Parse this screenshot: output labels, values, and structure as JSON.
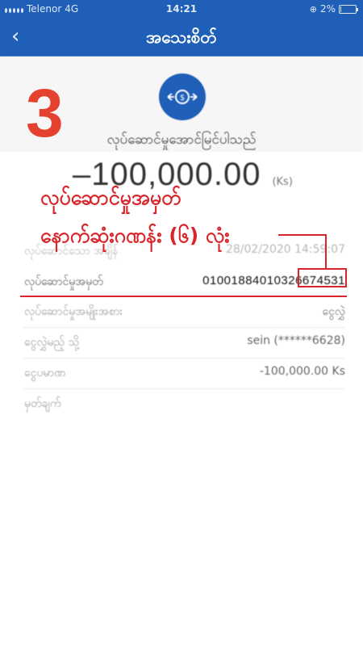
{
  "status": {
    "carrier": "Telenor",
    "network": "4G",
    "time": "14:21",
    "battery_percent": "2%",
    "battery_level": 0.02
  },
  "nav": {
    "back_icon": "chevron-left-icon",
    "title": "အသေးစိတ်"
  },
  "step_number": "3",
  "receipt": {
    "icon": "money-transfer-icon",
    "status_text": "လုပ်ဆောင်မှုအောင်မြင်ပါသည်",
    "amount": "–100,000.00",
    "currency": "(Ks)"
  },
  "callout": {
    "line1": "လုပ်ဆောင်မှုအမှတ်",
    "line2": "နောက်ဆုံးဂဏန်း (၆) လုံး"
  },
  "details": {
    "date_label": "လုပ်ဆောင်သော အချိန်",
    "date_value": "28/02/2020 14:59:07",
    "txid_label": "လုပ်ဆောင်မှုအမှတ်",
    "txid_prefix": "0100188401032",
    "txid_suffix": "6674531",
    "type_label": "လုပ်ဆောင်မှုအမျိုးအစား",
    "type_value": "ငွေလွှဲ",
    "receiver_label": "ငွေလွှဲမည့် သို့",
    "receiver_value": "sein (******6628)",
    "amount_label": "ငွေပမာဏ",
    "amount_value": "-100,000.00 Ks",
    "note_label": "မှတ်ချက်",
    "note_value": ""
  },
  "colors": {
    "brand_blue": "#1f5fb8",
    "annotation_red": "#d9262c",
    "step_red": "#e4412e"
  }
}
